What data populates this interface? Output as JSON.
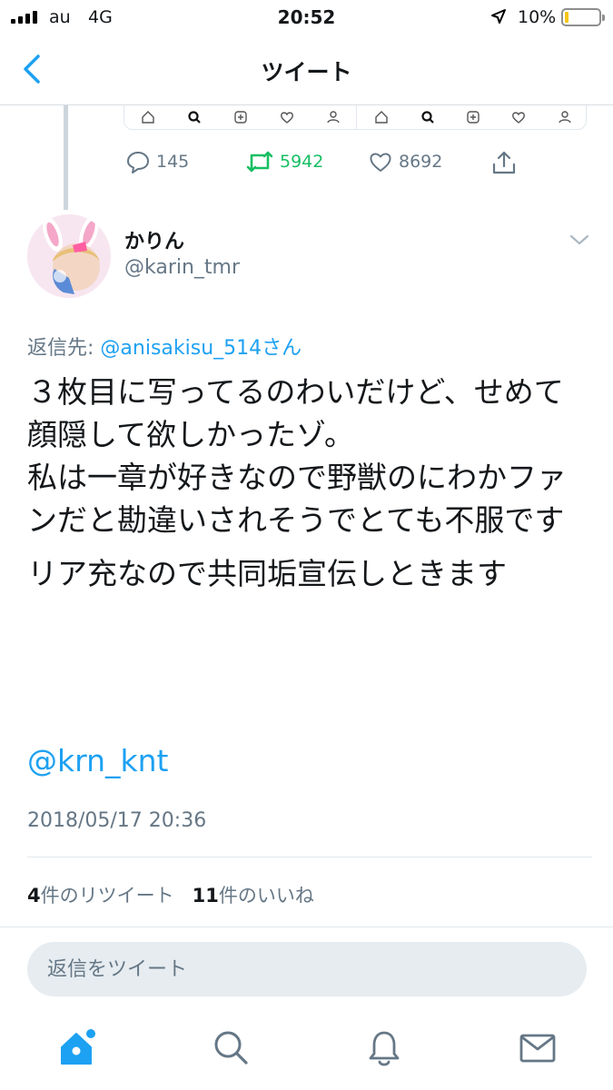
{
  "status_bar": {
    "carrier": "au",
    "network": "4G",
    "time": "20:52",
    "battery_percent": "10%",
    "icons": [
      "signal-bars-icon",
      "location-arrow-icon",
      "battery-low-icon"
    ]
  },
  "nav": {
    "title": "ツイート",
    "back_icon": "chevron-left-icon"
  },
  "previous_tweet": {
    "reply_count": "145",
    "retweet_count": "5942",
    "like_count": "8692",
    "retweeted": true,
    "accent_retweet": "#17bf63",
    "embedded_screenshot_tabs": [
      "home-icon",
      "search-icon",
      "add-icon",
      "heart-icon",
      "person-icon"
    ]
  },
  "tweet": {
    "display_name": "かりん",
    "handle": "@karin_tmr",
    "reply_to_prefix": "返信先:",
    "reply_to_user": "@anisakisu_514さん",
    "paragraphs": [
      "３枚目に写ってるのわいだけど、せめて顔隠して欲しかったゾ。\n私は一章が好きなので野獣のにわかファンだと勘違いされそうでとても不服です",
      "リア充なので共同垢宣伝しときます"
    ],
    "mention_link": "@krn_knt",
    "timestamp": "2018/05/17 20:36",
    "retweet_count": "4",
    "retweet_label": "件のリツイート",
    "like_count": "11",
    "like_label": "件のいいね"
  },
  "reply_input": {
    "placeholder": "返信をツイート",
    "value": ""
  },
  "tab_bar": {
    "items": [
      {
        "name": "home",
        "icon": "home-icon",
        "active": true
      },
      {
        "name": "search",
        "icon": "search-icon",
        "active": false
      },
      {
        "name": "notifications",
        "icon": "bell-icon",
        "active": false
      },
      {
        "name": "messages",
        "icon": "envelope-icon",
        "active": false
      }
    ]
  },
  "colors": {
    "accent": "#1da1f2",
    "secondary_text": "#657786",
    "primary_text": "#14171a",
    "divider": "#e1e8ed"
  }
}
